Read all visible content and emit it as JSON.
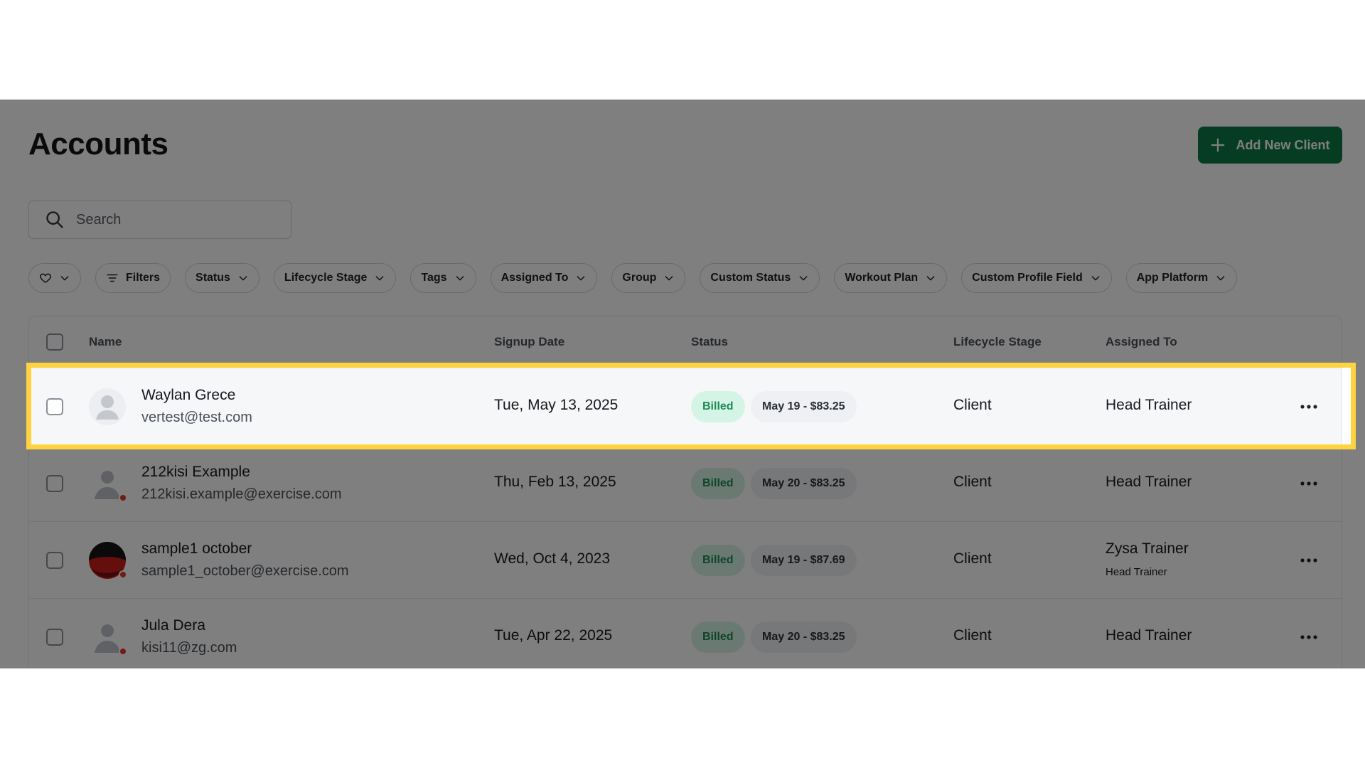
{
  "header": {
    "title": "Accounts",
    "add_button": "Add New Client"
  },
  "search": {
    "placeholder": "Search"
  },
  "filters": [
    {
      "label": "Filters"
    },
    {
      "label": "Status"
    },
    {
      "label": "Lifecycle Stage"
    },
    {
      "label": "Tags"
    },
    {
      "label": "Assigned To"
    },
    {
      "label": "Group"
    },
    {
      "label": "Custom Status"
    },
    {
      "label": "Workout Plan"
    },
    {
      "label": "Custom Profile Field"
    },
    {
      "label": "App Platform"
    }
  ],
  "table": {
    "columns": {
      "name": "Name",
      "signup_date": "Signup Date",
      "status": "Status",
      "lifecycle_stage": "Lifecycle Stage",
      "assigned_to": "Assigned To"
    },
    "rows": [
      {
        "name": "Waylan Grece",
        "email": "vertest@test.com",
        "signup_date": "Tue, May 13, 2025",
        "status_badge": "Billed",
        "billing": "May 19 - $83.25",
        "lifecycle_stage": "Client",
        "assigned_to": "Head Trainer",
        "assigned_sub": ""
      },
      {
        "name": "212kisi Example",
        "email": "212kisi.example@exercise.com",
        "signup_date": "Thu, Feb 13, 2025",
        "status_badge": "Billed",
        "billing": "May 20 - $83.25",
        "lifecycle_stage": "Client",
        "assigned_to": "Head Trainer",
        "assigned_sub": ""
      },
      {
        "name": "sample1 october",
        "email": "sample1_october@exercise.com",
        "signup_date": "Wed, Oct 4, 2023",
        "status_badge": "Billed",
        "billing": "May 19 - $87.69",
        "lifecycle_stage": "Client",
        "assigned_to": "Zysa Trainer",
        "assigned_sub": "Head Trainer"
      },
      {
        "name": "Jula Dera",
        "email": "kisi11@zg.com",
        "signup_date": "Tue, Apr 22, 2025",
        "status_badge": "Billed",
        "billing": "May 20 - $83.25",
        "lifecycle_stage": "Client",
        "assigned_to": "Head Trainer",
        "assigned_sub": ""
      }
    ]
  },
  "colors": {
    "accent": "#0c7a44",
    "billed_badge_bg": "#d4f5e6",
    "billed_badge_text": "#1f8a57",
    "highlight": "#ffd23f",
    "status_dot": "#e5342a"
  },
  "icons": {
    "add": "plus-icon",
    "search": "search-icon",
    "favorites": "heart-icon",
    "filters": "filter-lines-icon",
    "dropdown": "chevron-down-icon",
    "row_menu": "more-horizontal-icon",
    "avatar": "user-avatar-icon"
  }
}
